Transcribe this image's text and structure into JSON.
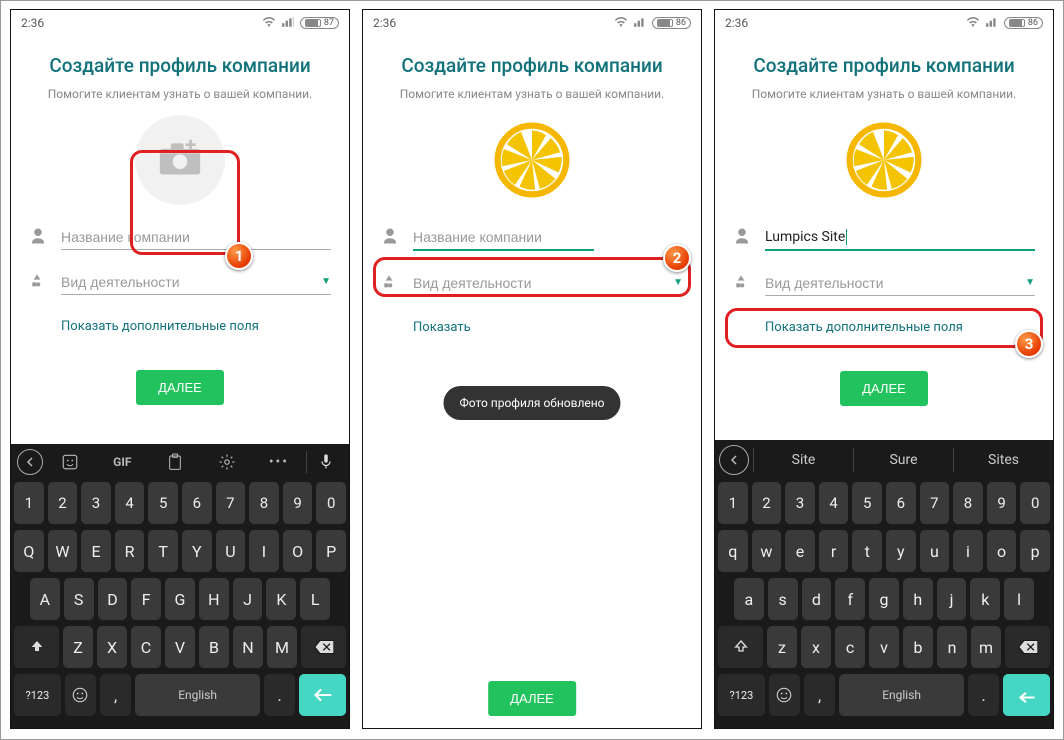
{
  "status": {
    "time": "2:36",
    "battery": [
      "87",
      "86",
      "86"
    ]
  },
  "common": {
    "title": "Создайте профиль компании",
    "subtitle": "Помогите клиентам узнать о вашей компании.",
    "company_placeholder": "Название компании",
    "activity_placeholder": "Вид деятельности",
    "show_more": "Показать дополнительные поля",
    "next": "ДАЛЕЕ",
    "toast": "Фото профиля обновлено"
  },
  "screen3": {
    "company_value": "Lumpics Site"
  },
  "keyboard": {
    "toolbar_gif": "GIF",
    "space_label": "English",
    "sym_label": "?123",
    "row_num": [
      "1",
      "2",
      "3",
      "4",
      "5",
      "6",
      "7",
      "8",
      "9",
      "0"
    ],
    "row_q_upper": [
      "Q",
      "W",
      "E",
      "R",
      "T",
      "Y",
      "U",
      "I",
      "O",
      "P"
    ],
    "row_q_lower": [
      "q",
      "w",
      "e",
      "r",
      "t",
      "y",
      "u",
      "i",
      "o",
      "p"
    ],
    "row_a_upper": [
      "A",
      "S",
      "D",
      "F",
      "G",
      "H",
      "J",
      "K",
      "L"
    ],
    "row_a_lower": [
      "a",
      "s",
      "d",
      "f",
      "g",
      "h",
      "j",
      "k",
      "l"
    ],
    "row_z_upper": [
      "Z",
      "X",
      "C",
      "V",
      "B",
      "N",
      "M"
    ],
    "row_z_lower": [
      "z",
      "x",
      "c",
      "v",
      "b",
      "n",
      "m"
    ],
    "comma": ",",
    "period": ".",
    "suggestions": [
      "Site",
      "Sure",
      "Sites"
    ]
  },
  "badges": {
    "b1": "1",
    "b2": "2",
    "b3": "3"
  },
  "colors": {
    "accent": "#11727a",
    "green": "#22c35e",
    "teal": "#46d6c4",
    "red": "#e02020"
  }
}
